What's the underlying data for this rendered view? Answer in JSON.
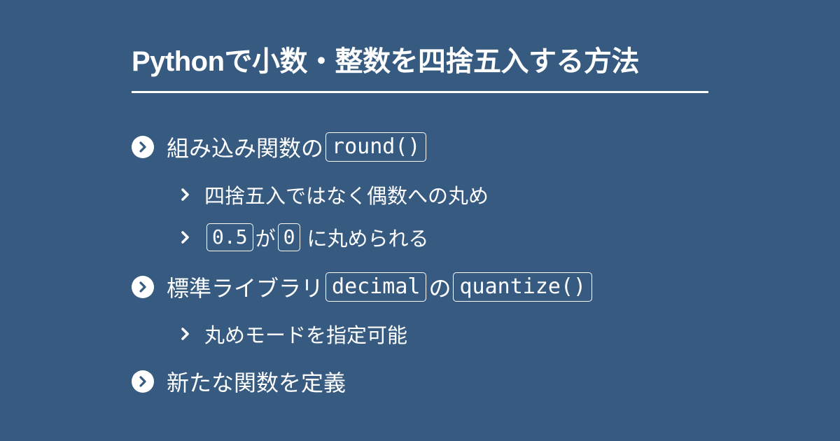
{
  "page": {
    "background_color": "#365a80",
    "text_color": "#ffffff"
  },
  "header": {
    "title": "Pythonで小数・整数を四捨五入する方法"
  },
  "items": [
    {
      "level": 1,
      "icon": "chevron-circle-icon",
      "segments": [
        {
          "type": "text",
          "value": "組み込み関数の"
        },
        {
          "type": "code",
          "value": "round()"
        }
      ]
    },
    {
      "level": 2,
      "icon": "chevron-right-icon",
      "segments": [
        {
          "type": "text",
          "value": "四捨五入ではなく偶数への丸め"
        }
      ]
    },
    {
      "level": 2,
      "icon": "chevron-right-icon",
      "segments": [
        {
          "type": "code",
          "value": "0.5"
        },
        {
          "type": "text",
          "value": "が"
        },
        {
          "type": "code",
          "value": "0"
        },
        {
          "type": "text",
          "value": "に丸められる"
        }
      ]
    },
    {
      "level": 1,
      "icon": "chevron-circle-icon",
      "segments": [
        {
          "type": "text",
          "value": "標準ライブラリ"
        },
        {
          "type": "code",
          "value": "decimal"
        },
        {
          "type": "text",
          "value": "の"
        },
        {
          "type": "code",
          "value": "quantize()"
        }
      ]
    },
    {
      "level": 2,
      "icon": "chevron-right-icon",
      "segments": [
        {
          "type": "text",
          "value": "丸めモードを指定可能"
        }
      ]
    },
    {
      "level": 1,
      "icon": "chevron-circle-icon",
      "segments": [
        {
          "type": "text",
          "value": "新たな関数を定義"
        }
      ]
    }
  ]
}
